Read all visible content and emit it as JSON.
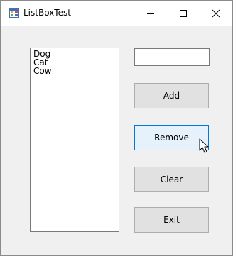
{
  "window": {
    "title": "ListBoxTest",
    "icons": {
      "app": "application-icon",
      "minimize": "minimize-icon",
      "maximize": "maximize-icon",
      "close": "close-icon"
    }
  },
  "listbox": {
    "items": [
      "Dog",
      "Cat",
      "Cow"
    ]
  },
  "textbox": {
    "value": ""
  },
  "buttons": {
    "add_label": "Add",
    "remove_label": "Remove",
    "clear_label": "Clear",
    "exit_label": "Exit"
  },
  "state": {
    "hovered_button": "remove"
  },
  "colors": {
    "button_hover_border": "#0078d7",
    "button_hover_fill": "#e5f1fb",
    "button_fill": "#e1e1e1"
  }
}
